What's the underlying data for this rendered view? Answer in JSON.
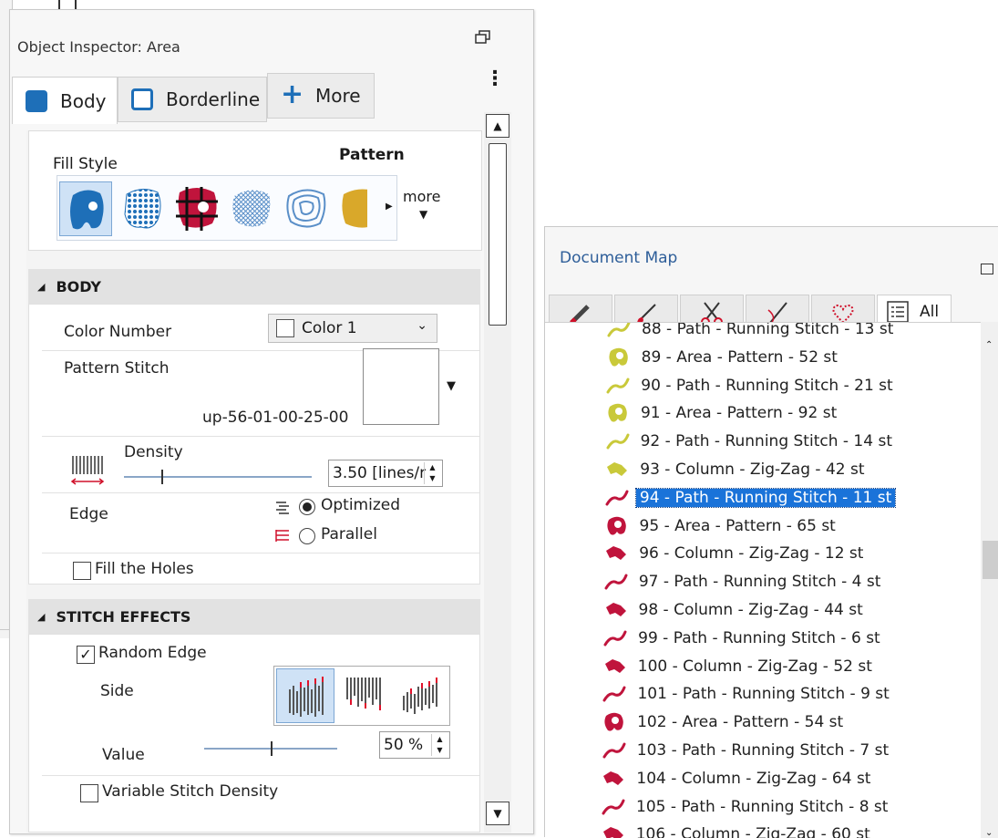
{
  "inspector": {
    "title": "Object Inspector: Area",
    "tabs": [
      {
        "label": "Body",
        "icon": "body-square-icon"
      },
      {
        "label": "Borderline",
        "icon": "borderline-square-icon"
      },
      {
        "label": "More",
        "icon": "plus-icon"
      }
    ],
    "fill_style": {
      "label": "Fill Style",
      "value": "Pattern",
      "more_label": "more",
      "swatches": [
        "pattern-fill-icon",
        "dot-fill-icon",
        "tartan-fill-icon",
        "mesh-fill-icon",
        "contour-fill-icon",
        "gold-fill-icon"
      ]
    },
    "body_section": {
      "title": "BODY",
      "color_number_label": "Color Number",
      "color_number_value": "Color 1",
      "pattern_stitch_label": "Pattern Stitch",
      "pattern_stitch_value": "up-56-01-00-25-00",
      "density_label": "Density",
      "density_value": "3.50 [lines/r",
      "density_level": 0.2,
      "edge_label": "Edge",
      "edge_options": [
        "Optimized",
        "Parallel"
      ],
      "edge_selected": "Optimized",
      "fill_holes_label": "Fill the Holes",
      "fill_holes_checked": false
    },
    "stitch_effects": {
      "title": "STITCH EFFECTS",
      "random_edge_label": "Random Edge",
      "random_edge_checked": true,
      "side_label": "Side",
      "side_options": [
        "side-both-icon",
        "side-bottom-icon",
        "side-top-icon"
      ],
      "value_label": "Value",
      "value_value": "50 %",
      "value_level": 0.5,
      "variable_density_label": "Variable Stitch Density",
      "variable_density_checked": false
    }
  },
  "docmap": {
    "title": "Document Map",
    "tabs": [
      "pencil-icon",
      "brush-icon",
      "scissors-icon",
      "needle-icon",
      "heart-outline-icon",
      "list-icon"
    ],
    "all_label": "All",
    "colors": {
      "yellow": "#c9c93a",
      "red": "#c0143c",
      "selection": "#1a73d9"
    },
    "items": [
      {
        "label": "88 - Path - Running Stitch - 13 st",
        "icon": "path-icon",
        "color": "yellow"
      },
      {
        "label": "89 - Area - Pattern - 52 st",
        "icon": "area-icon",
        "color": "yellow"
      },
      {
        "label": "90 - Path - Running Stitch - 21 st",
        "icon": "path-icon",
        "color": "yellow"
      },
      {
        "label": "91 - Area - Pattern - 92 st",
        "icon": "area-icon",
        "color": "yellow"
      },
      {
        "label": "92 - Path - Running Stitch - 14 st",
        "icon": "path-icon",
        "color": "yellow"
      },
      {
        "label": "93 - Column - Zig-Zag - 42 st",
        "icon": "column-icon",
        "color": "yellow"
      },
      {
        "label": "94 - Path - Running Stitch - 11 st",
        "icon": "path-icon",
        "color": "red",
        "selected": true
      },
      {
        "label": "95 - Area - Pattern - 65 st",
        "icon": "area-icon",
        "color": "red"
      },
      {
        "label": "96 - Column - Zig-Zag - 12 st",
        "icon": "column-icon",
        "color": "red"
      },
      {
        "label": "97 - Path - Running Stitch - 4 st",
        "icon": "path-icon",
        "color": "red"
      },
      {
        "label": "98 - Column - Zig-Zag - 44 st",
        "icon": "column-icon",
        "color": "red"
      },
      {
        "label": "99 - Path - Running Stitch - 6 st",
        "icon": "path-icon",
        "color": "red"
      },
      {
        "label": "100 - Column - Zig-Zag - 52 st",
        "icon": "column-icon",
        "color": "red"
      },
      {
        "label": "101 - Path - Running Stitch - 9 st",
        "icon": "path-icon",
        "color": "red"
      },
      {
        "label": "102 - Area - Pattern - 54 st",
        "icon": "area-icon",
        "color": "red"
      },
      {
        "label": "103 - Path - Running Stitch - 7 st",
        "icon": "path-icon",
        "color": "red"
      },
      {
        "label": "104 - Column - Zig-Zag - 64 st",
        "icon": "column-icon",
        "color": "red"
      },
      {
        "label": "105 - Path - Running Stitch - 8 st",
        "icon": "path-icon",
        "color": "red"
      },
      {
        "label": "106 - Column - Zig-Zag - 60 st",
        "icon": "column-icon",
        "color": "red"
      }
    ]
  }
}
